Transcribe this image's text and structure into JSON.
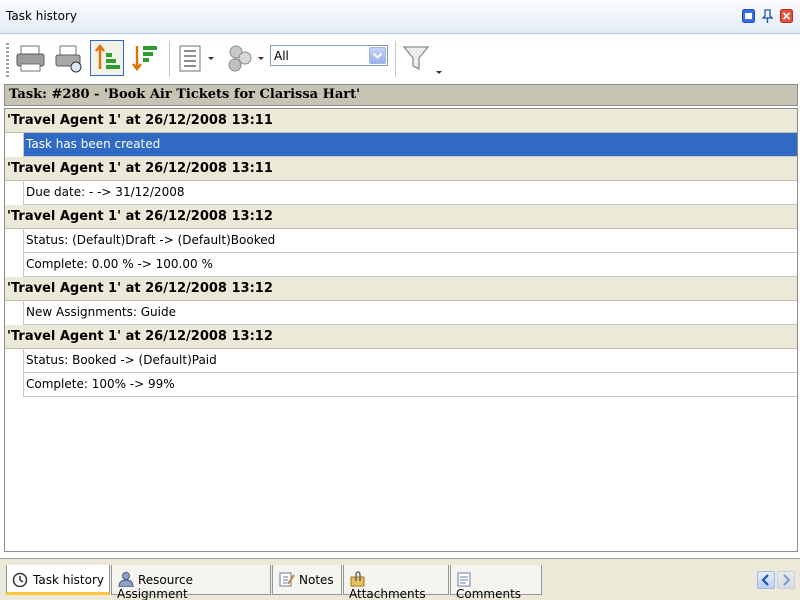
{
  "window": {
    "title": "Task history"
  },
  "toolbar": {
    "filter_value": "All"
  },
  "task": {
    "header": "Task: #280 - 'Book Air Tickets for Clarissa Hart'"
  },
  "history": [
    {
      "header": "'Travel Agent 1' at 26/12/2008 13:11",
      "entries": [
        "Task has been created"
      ]
    },
    {
      "header": "'Travel Agent 1' at 26/12/2008 13:11",
      "entries": [
        "Due date:  - -> 31/12/2008"
      ]
    },
    {
      "header": "'Travel Agent 1' at 26/12/2008 13:12",
      "entries": [
        "Status: (Default)Draft -> (Default)Booked",
        "Complete: 0.00 % -> 100.00 %"
      ]
    },
    {
      "header": "'Travel Agent 1' at 26/12/2008 13:12",
      "entries": [
        "New Assignments: Guide"
      ]
    },
    {
      "header": "'Travel Agent 1' at 26/12/2008 13:12",
      "entries": [
        "Status: Booked -> (Default)Paid",
        "Complete: 100% -> 99%"
      ]
    }
  ],
  "tabs": [
    {
      "label": "Task history",
      "icon": "clock-icon"
    },
    {
      "label": "Resource Assignment",
      "icon": "person-icon"
    },
    {
      "label": "Notes",
      "icon": "notes-icon"
    },
    {
      "label": "Attachments",
      "icon": "paperclip-icon"
    },
    {
      "label": "Comments",
      "icon": "comments-icon"
    }
  ],
  "colors": {
    "selection": "#316ac5",
    "group_header": "#ece9d8",
    "task_header": "#c8c4b4",
    "close_button": "#e6503c"
  }
}
